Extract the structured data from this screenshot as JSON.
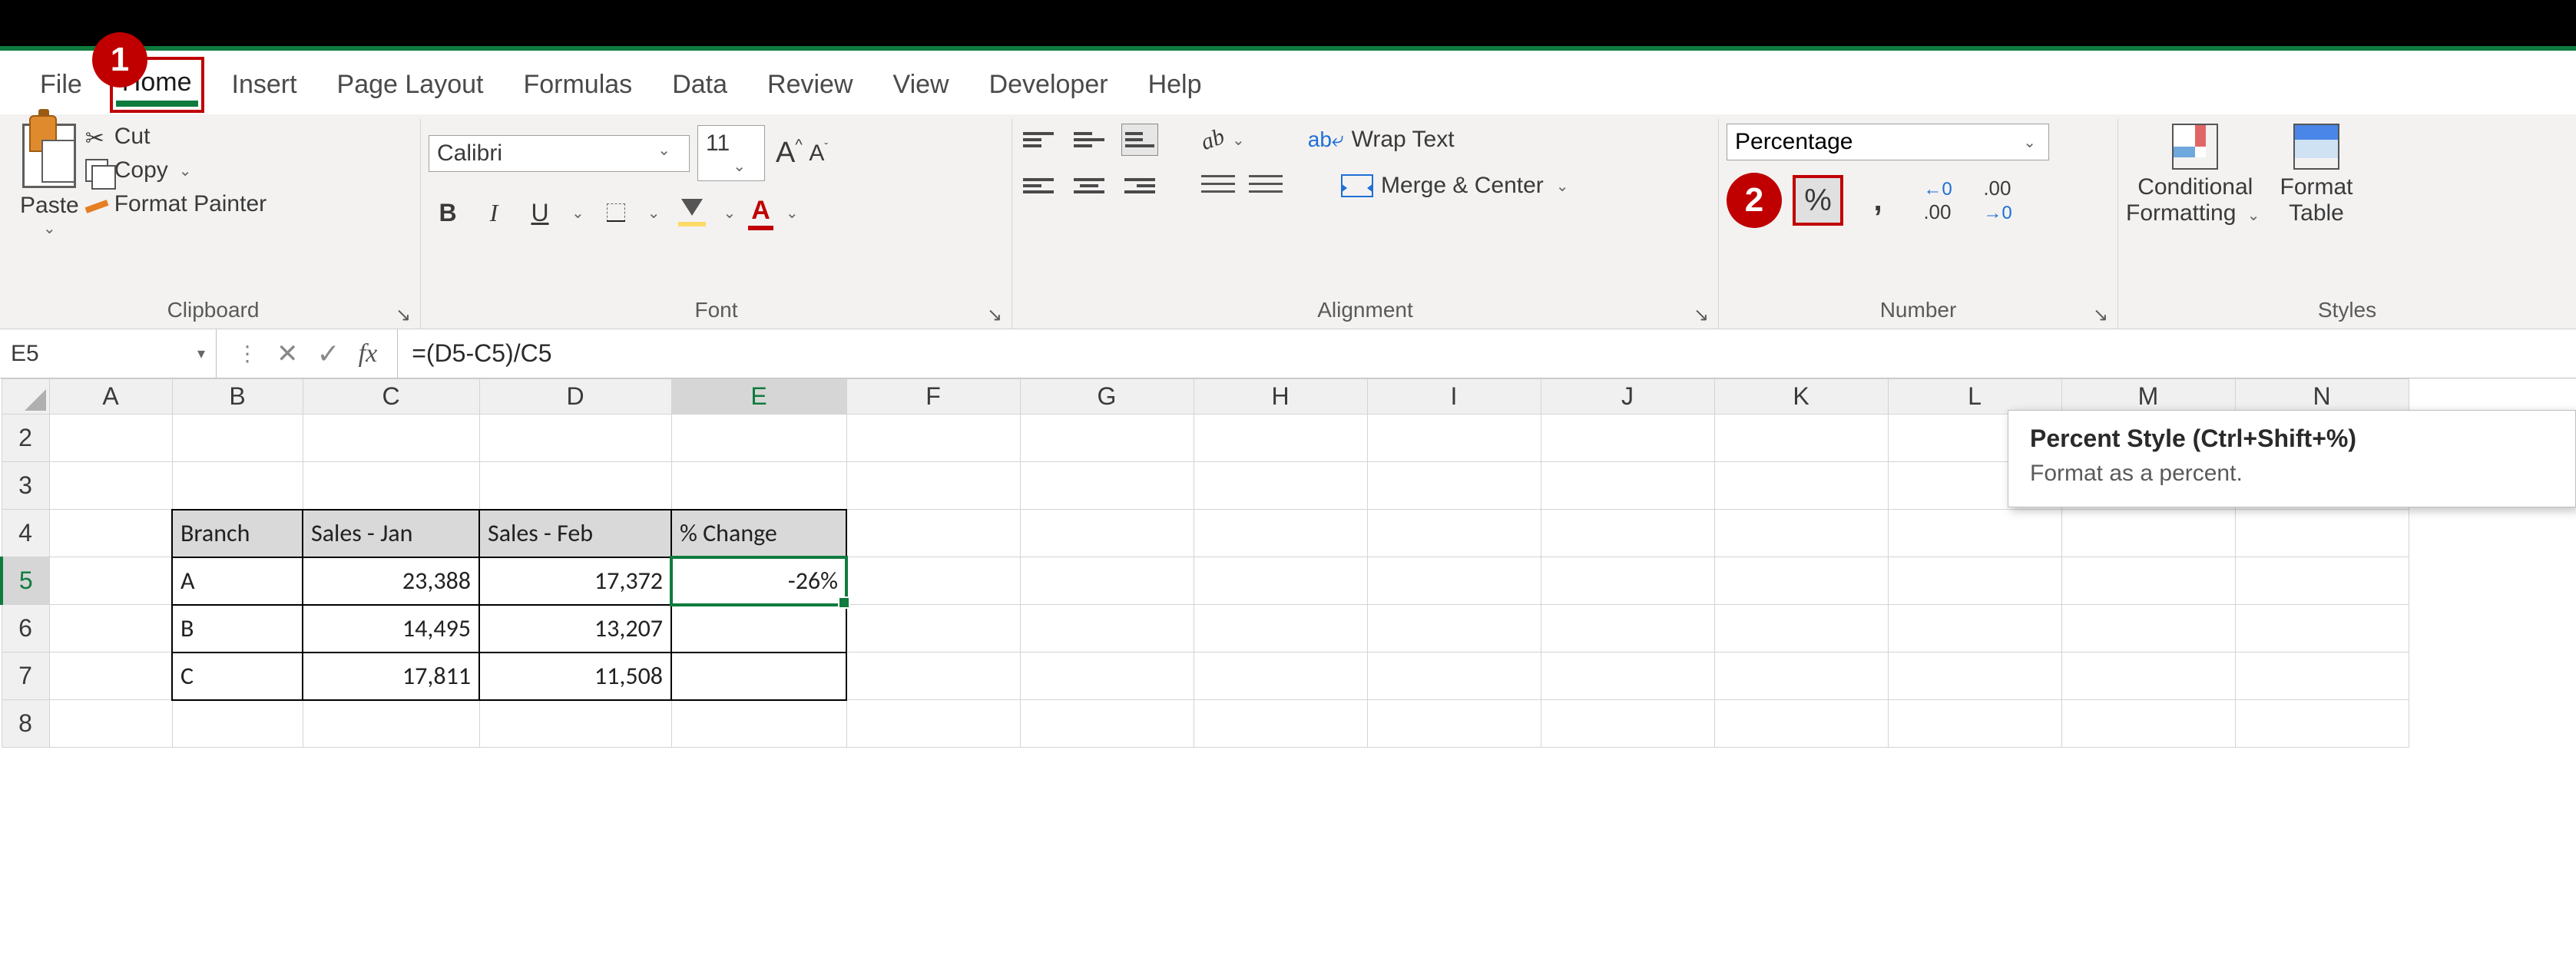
{
  "tabs": {
    "file": "File",
    "home": "Home",
    "insert": "Insert",
    "page_layout": "Page Layout",
    "formulas": "Formulas",
    "data": "Data",
    "review": "Review",
    "view": "View",
    "developer": "Developer",
    "help": "Help"
  },
  "callouts": {
    "one": "1",
    "two": "2"
  },
  "clipboard": {
    "label": "Clipboard",
    "paste": "Paste",
    "cut": "Cut",
    "copy": "Copy",
    "format_painter": "Format Painter"
  },
  "font": {
    "label": "Font",
    "name": "Calibri",
    "size": "11",
    "grow": "A",
    "shrink": "A"
  },
  "alignment": {
    "label": "Alignment",
    "wrap": "Wrap Text",
    "merge": "Merge & Center"
  },
  "number": {
    "label": "Number",
    "format": "Percentage",
    "currency": "$",
    "percent": "%",
    "comma": ","
  },
  "decimals": {
    "inc_top": "←0",
    "inc_bot": ".00",
    "dec_top": ".00",
    "dec_bot": "→0"
  },
  "styles_group": {
    "label": "Styles",
    "cond": "Conditional",
    "cond2": "Formatting",
    "fmt_table1": "Format",
    "fmt_table2": "Table"
  },
  "formula_bar": {
    "cell_ref": "E5",
    "formula": "=(D5-C5)/C5"
  },
  "tooltip": {
    "title": "Percent Style (Ctrl+Shift+%)",
    "body": "Format as a percent."
  },
  "columns": [
    "A",
    "B",
    "C",
    "D",
    "E",
    "F",
    "G",
    "H",
    "I",
    "J",
    "K",
    "L",
    "M",
    "N"
  ],
  "rows": [
    "2",
    "3",
    "4",
    "5",
    "6",
    "7",
    "8"
  ],
  "sheet": {
    "headers": {
      "branch": "Branch",
      "jan": "Sales - Jan",
      "feb": "Sales - Feb",
      "chg": "% Change"
    },
    "r5": {
      "branch": "A",
      "jan": "23,388",
      "feb": "17,372",
      "chg": "-26%"
    },
    "r6": {
      "branch": "B",
      "jan": "14,495",
      "feb": "13,207"
    },
    "r7": {
      "branch": "C",
      "jan": "17,811",
      "feb": "11,508"
    }
  }
}
